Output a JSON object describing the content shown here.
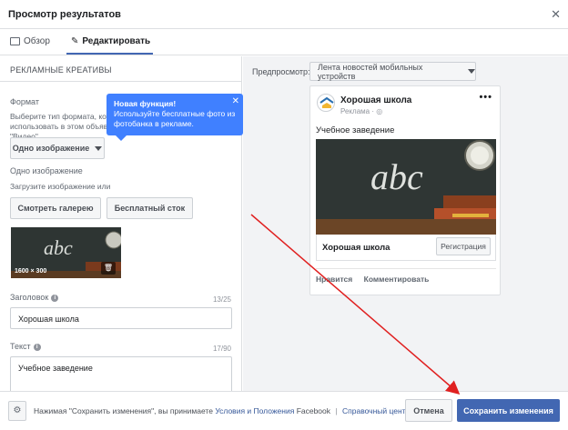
{
  "dialog": {
    "title": "Просмотр результатов",
    "close_icon": "close-icon"
  },
  "tabs": [
    {
      "label": "Обзор",
      "icon": "monitor-icon",
      "active": false
    },
    {
      "label": "Редактировать",
      "icon": "pencil-icon",
      "active": true
    }
  ],
  "left": {
    "section_title": "РЕКЛАМНЫЕ КРЕАТИВЫ",
    "format_label": "Формат",
    "format_desc": "Выберите тип формата, который вы хотели бы использовать в этом объявлении: \"Изображение\" или \"Видео\".",
    "format_select": "Одно изображение",
    "image_label": "Одно изображение",
    "image_desc": "Загрузите изображение или",
    "gallery_button": "Смотреть галерею",
    "stock_button": "Бесплатный сток",
    "thumb_size": "1600 × 300",
    "headline_label": "Заголовок",
    "headline_counter": "13/25",
    "headline_value": "Хорошая школа",
    "text_label": "Текст",
    "text_counter": "17/90",
    "text_value": "Учебное заведение"
  },
  "tooltip": {
    "title": "Новая функция!",
    "body": "Используйте бесплатные фото из фотобанка в рекламе."
  },
  "preview": {
    "label": "Предпросмотр:",
    "placement": "Лента новостей мобильных устройств",
    "page_name": "Хорошая школа",
    "sponsored": "Реклама · ",
    "post_text": "Учебное заведение",
    "link_title": "Хорошая школа",
    "cta": "Регистрация",
    "like": "Нравится",
    "comment": "Комментировать"
  },
  "footer": {
    "settings_icon": "gear-icon",
    "terms_prefix": "Нажимая \"Сохранить изменения\", вы принимаете",
    "terms_link": "Условия и Положения",
    "terms_suffix": "Facebook",
    "help_link": "Справочный центр",
    "cancel": "Отмена",
    "save": "Сохранить изменения"
  },
  "colors": {
    "accent": "#4267b2",
    "tooltip": "#4080ff",
    "annotation_arrow": "#e02020"
  }
}
